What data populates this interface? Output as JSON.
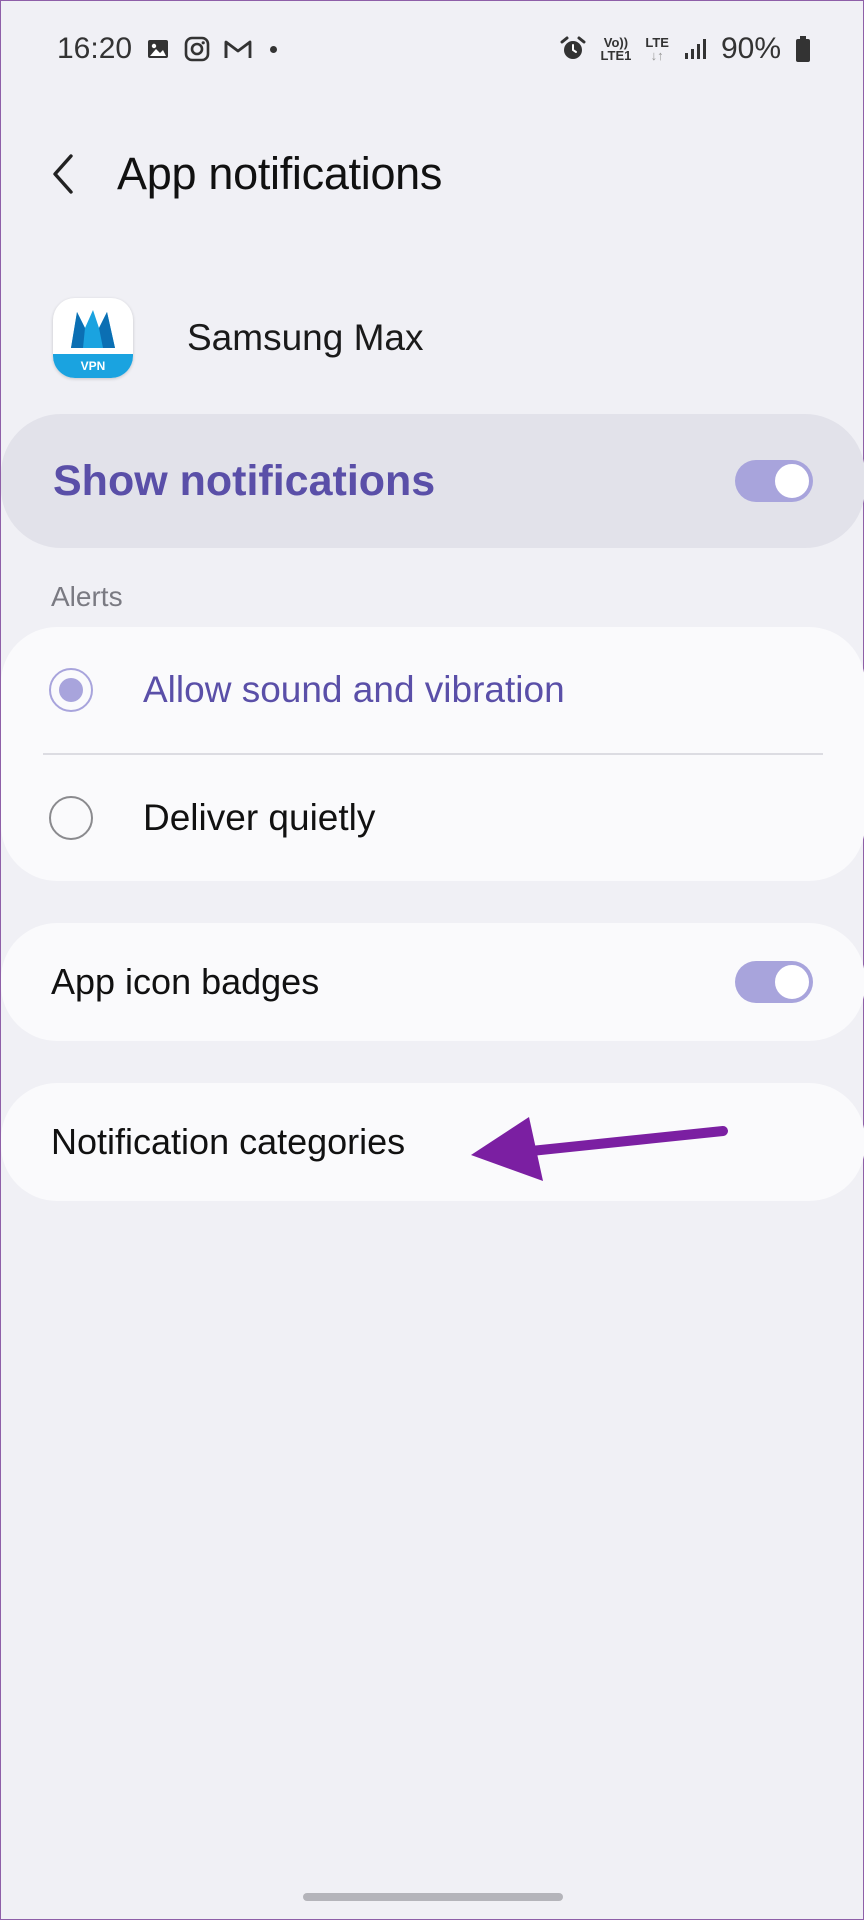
{
  "status_bar": {
    "time": "16:20",
    "left_icons": [
      "gallery-icon",
      "instagram-icon",
      "gmail-icon"
    ],
    "volte_top": "Vo))",
    "volte_bottom": "LTE1",
    "lte_top": "LTE",
    "lte_bottom": "↓↑",
    "battery": "90%"
  },
  "header": {
    "title": "App notifications"
  },
  "app": {
    "name": "Samsung Max",
    "icon_badge_text": "VPN"
  },
  "show_notifications": {
    "label": "Show notifications",
    "enabled": true
  },
  "alerts": {
    "section_label": "Alerts",
    "options": [
      {
        "label": "Allow sound and vibration",
        "selected": true
      },
      {
        "label": "Deliver quietly",
        "selected": false
      }
    ]
  },
  "app_icon_badges": {
    "label": "App icon badges",
    "enabled": true
  },
  "notification_categories": {
    "label": "Notification categories"
  },
  "colors": {
    "accent": "#5a4fa8",
    "toggle_on": "#a8a4dc",
    "annotation_arrow": "#7b1fa2"
  }
}
